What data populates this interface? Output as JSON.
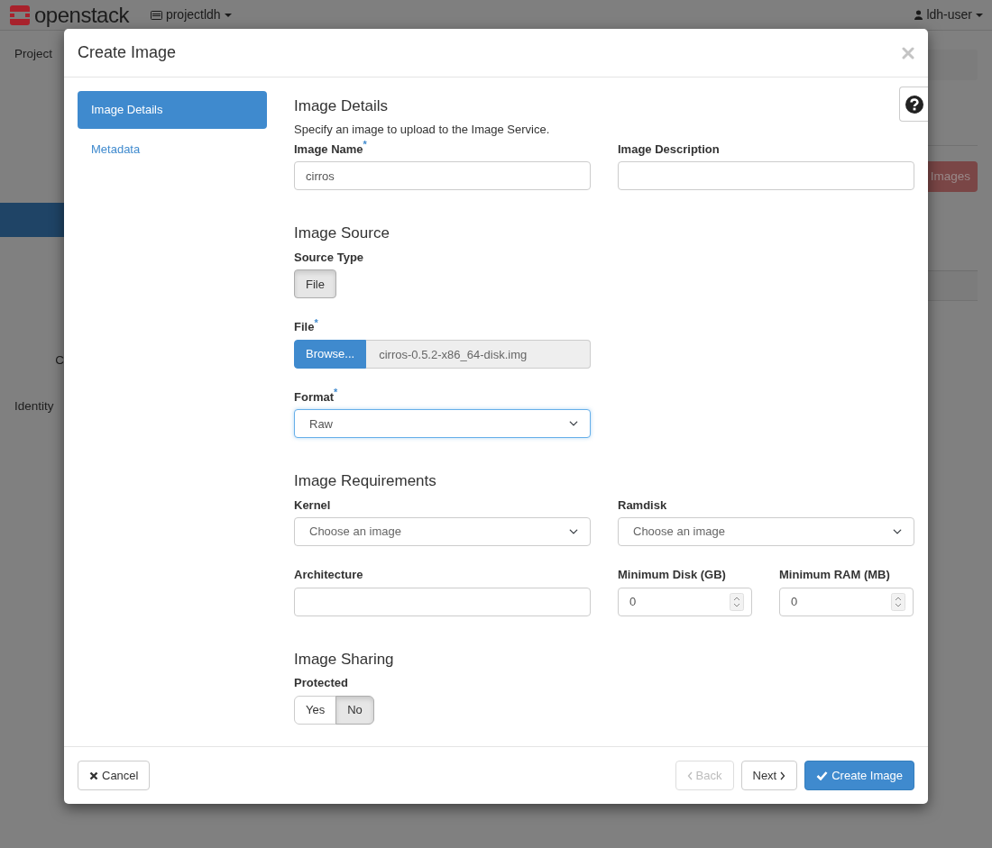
{
  "navbar": {
    "brand": "openstack",
    "project": "projectldh",
    "user": "ldh-user"
  },
  "sidebar": {
    "items": [
      {
        "label": "Project",
        "selected": false
      },
      {
        "selected": true
      },
      {
        "label": "C",
        "selected": false,
        "kind": "sub"
      },
      {
        "label": "Identity",
        "selected": false
      }
    ]
  },
  "page": {
    "action_button": "Images"
  },
  "modal": {
    "title": "Create Image",
    "steps": [
      {
        "label": "Image Details",
        "selected": true
      },
      {
        "label": "Metadata",
        "selected": false
      }
    ],
    "sections": [
      {
        "title": "Image Details",
        "description": "Specify an image to upload to the Image Service.",
        "rows": [
          [
            {
              "kind": "text",
              "label": "Image Name$^{*}$",
              "value": "cirros"
            },
            {
              "kind": "text",
              "label": "Image Description"
            }
          ]
        ]
      },
      {
        "title": "Image Source",
        "rows": [
          [
            {
              "kind": "toggle",
              "label": "Source Type",
              "options": [
                {
                  "label": "File",
                  "selected": true
                }
              ]
            }
          ],
          [
            {
              "kind": "file",
              "label": "File$^{*}$",
              "button": "Browse...",
              "value": "cirros-0.5.2-x86_64-disk.img"
            }
          ],
          [
            {
              "kind": "select",
              "label": "Format$^{*}$",
              "value": "Raw",
              "focused": true
            }
          ]
        ]
      },
      {
        "title": "Image Requirements",
        "rows": [
          [
            {
              "kind": "select",
              "label": "Kernel",
              "placeholder": "Choose an image",
              "focused": false
            },
            {
              "kind": "select",
              "label": "Ramdisk",
              "placeholder": "Choose an image",
              "focused": false
            }
          ],
          [
            {
              "kind": "text",
              "label": "Architecture"
            },
            {
              "kind": "number",
              "label": "Minimum Disk (GB)",
              "value": "0"
            },
            {
              "kind": "number",
              "label": "Minimum RAM (MB)",
              "value": "0"
            }
          ]
        ]
      },
      {
        "title": "Image Sharing",
        "rows": [
          [
            {
              "kind": "toggle",
              "label": "Protected",
              "options": [
                {
                  "label": "Yes",
                  "selected": false
                },
                {
                  "label": "No",
                  "selected": true
                }
              ]
            }
          ]
        ]
      }
    ],
    "footer": {
      "cancel": "Cancel",
      "back": {
        "label": "Back",
        "disabled": true
      },
      "next": {
        "label": "Next",
        "disabled": false
      },
      "submit": "Create Image"
    }
  }
}
